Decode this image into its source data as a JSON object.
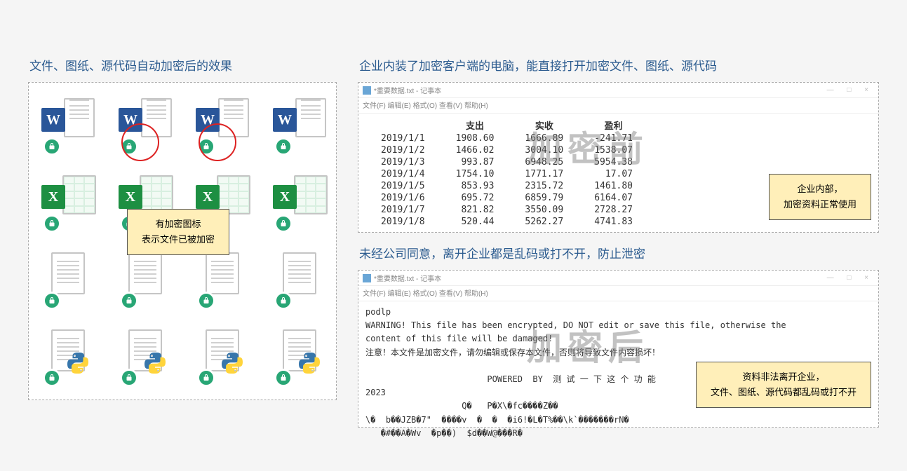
{
  "left": {
    "heading": "文件、图纸、源代码自动加密后的效果",
    "callout_line1": "有加密图标",
    "callout_line2": "表示文件已被加密"
  },
  "right_top": {
    "heading": "企业内装了加密客户端的电脑，能直接打开加密文件、图纸、源代码",
    "window_title": "*重要数据.txt - 记事本",
    "menu": "文件(F)  编辑(E)  格式(O)  查看(V)  帮助(H)",
    "watermark": "加密前",
    "callout_line1": "企业内部，",
    "callout_line2": "加密资料正常使用",
    "table": {
      "headers": [
        "",
        "支出",
        "实收",
        "盈利"
      ],
      "rows": [
        [
          "2019/1/1",
          "1908.60",
          "1666.89",
          "-241.71"
        ],
        [
          "2019/1/2",
          "1466.02",
          "3004.10",
          "1538.07"
        ],
        [
          "2019/1/3",
          "993.87",
          "6948.25",
          "5954.38"
        ],
        [
          "2019/1/4",
          "1754.10",
          "1771.17",
          "17.07"
        ],
        [
          "2019/1/5",
          "853.93",
          "2315.72",
          "1461.80"
        ],
        [
          "2019/1/6",
          "695.72",
          "6859.79",
          "6164.07"
        ],
        [
          "2019/1/7",
          "821.82",
          "3550.09",
          "2728.27"
        ],
        [
          "2019/1/8",
          "520.44",
          "5262.27",
          "4741.83"
        ]
      ]
    }
  },
  "right_bottom": {
    "heading": "未经公司同意，离开企业都是乱码或打不开，防止泄密",
    "window_title": "*重要数据.txt - 记事本",
    "menu": "文件(F)  编辑(E)  格式(O)  查看(V)  帮助(H)",
    "watermark": "加密后",
    "callout_line1": "资料非法离开企业，",
    "callout_line2": "文件、图纸、源代码都乱码或打不开",
    "body_lines": [
      "podlp",
      "WARNING! This file has been encrypted, DO NOT edit or save this file, otherwise the",
      "content of this file will be damaged!",
      "注意！本文件是加密文件，请勿编辑或保存本文件，否则将导致文件内容损坏！",
      "",
      "                        POWERED  BY  测 试 一 下 这 个 功 能",
      "2023",
      "                   Q�   P�X\\�fc����Z��",
      "\\�  b��JZB�7\"  ����v  �  �  �i6!�L�T%��\\k`�������rN�",
      "   �#��A�Wv  �p��)  $d��W@���R�"
    ]
  }
}
